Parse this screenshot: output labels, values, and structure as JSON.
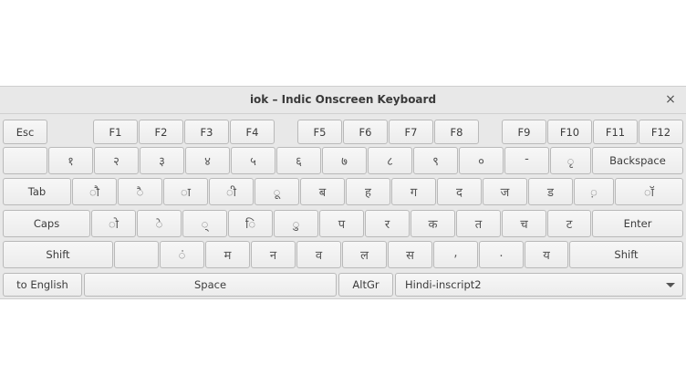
{
  "window": {
    "title": "iok – Indic Onscreen Keyboard",
    "close_icon": "×"
  },
  "row_fn": [
    "Esc",
    "F1",
    "F2",
    "F3",
    "F4",
    "F5",
    "F6",
    "F7",
    "F8",
    "F9",
    "F10",
    "F11",
    "F12"
  ],
  "row_num": [
    "",
    "१",
    "२",
    "३",
    "४",
    "५",
    "६",
    "७",
    "८",
    "९",
    "०",
    "-",
    "ृ",
    "Backspace"
  ],
  "row_tab": [
    "Tab",
    "ौ",
    "ै",
    "ा",
    "ी",
    "ू",
    "ब",
    "ह",
    "ग",
    "द",
    "ज",
    "ड",
    "़",
    "ॉ"
  ],
  "row_caps": [
    "Caps",
    "ो",
    "े",
    "्",
    "ि",
    "ु",
    "प",
    "र",
    "क",
    "त",
    "च",
    "ट",
    "Enter"
  ],
  "row_shift": [
    "Shift",
    "",
    "ं",
    "म",
    "न",
    "व",
    "ल",
    "स",
    ",",
    ".",
    "य",
    "Shift"
  ],
  "row_bottom": {
    "to_english": "to English",
    "space": "Space",
    "altgr": "AltGr"
  },
  "layout_select": {
    "value": "Hindi-inscript2"
  }
}
